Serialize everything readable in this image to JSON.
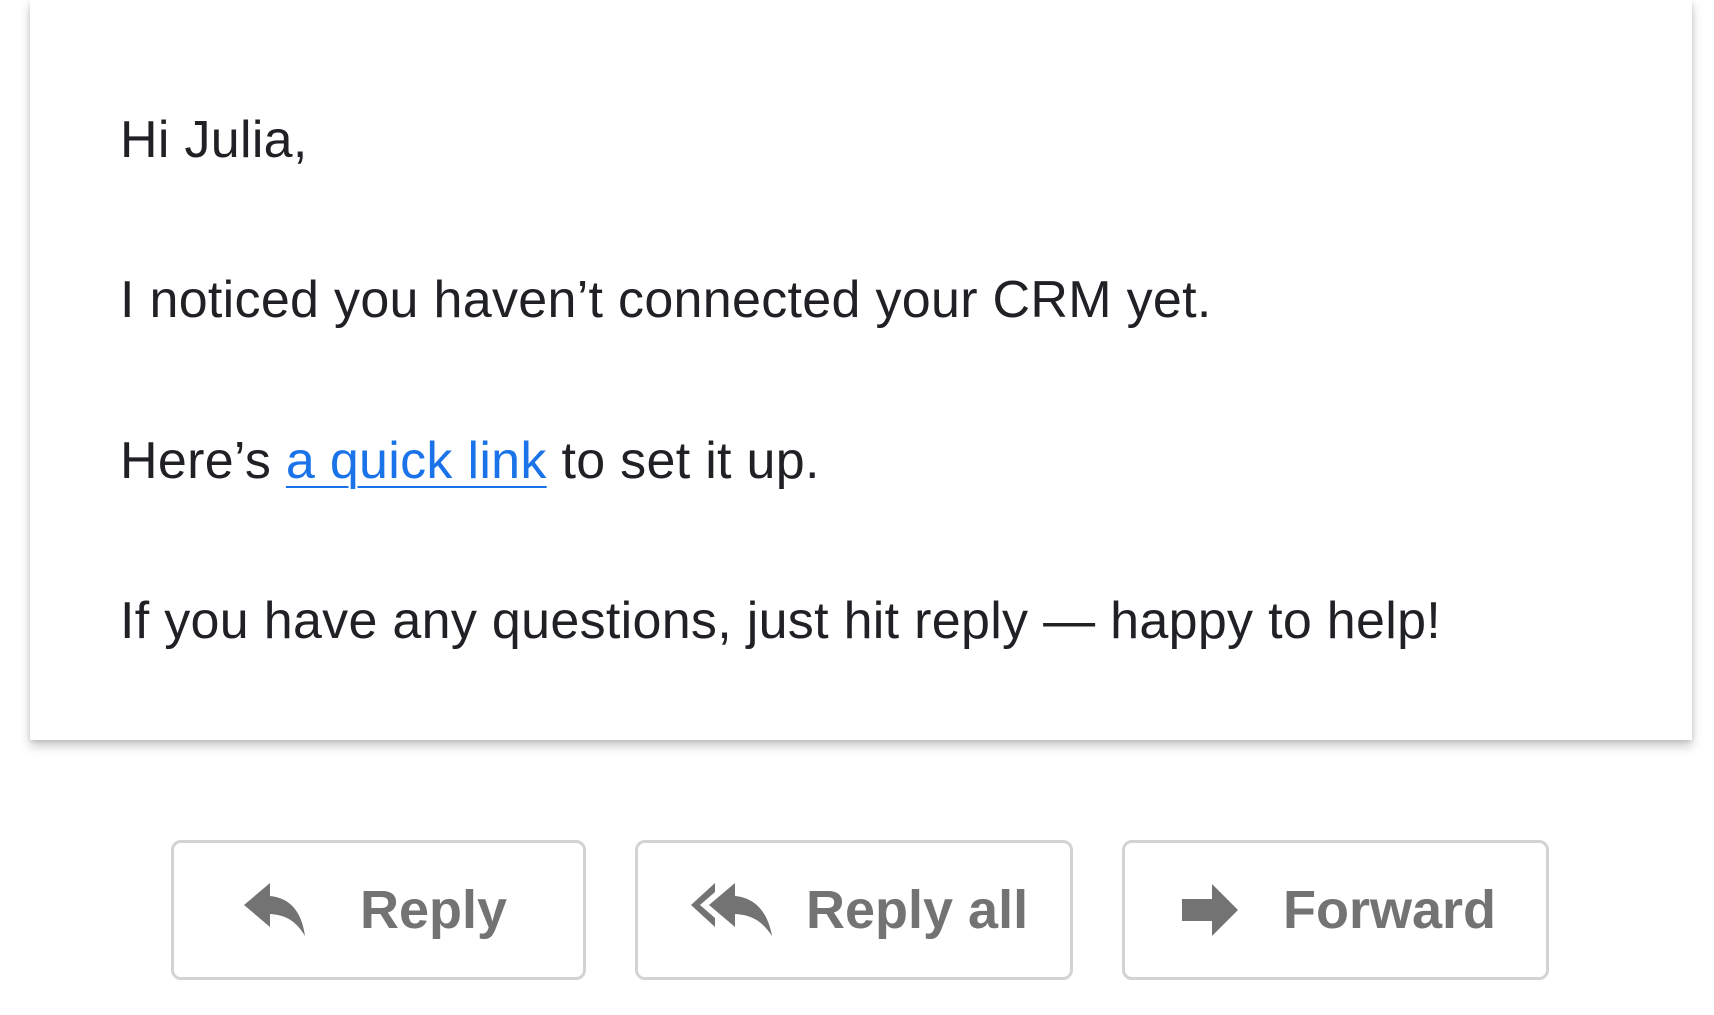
{
  "email": {
    "greeting": "Hi Julia,",
    "line1": "I noticed you haven’t connected your CRM yet.",
    "line2_prefix": "Here’s ",
    "line2_link": "a quick link",
    "line2_suffix": " to set it up.",
    "line3": "If you have any questions, just hit reply — happy to help!"
  },
  "actions": {
    "reply_label": "Reply",
    "reply_icon": "reply-arrow-icon",
    "reply_all_label": "Reply all",
    "reply_all_icon": "reply-all-arrow-icon",
    "forward_label": "Forward",
    "forward_icon": "forward-arrow-icon"
  },
  "colors": {
    "text": "#202124",
    "link": "#1a73e8",
    "button_text": "#737373",
    "button_border": "#d3d3d3"
  }
}
